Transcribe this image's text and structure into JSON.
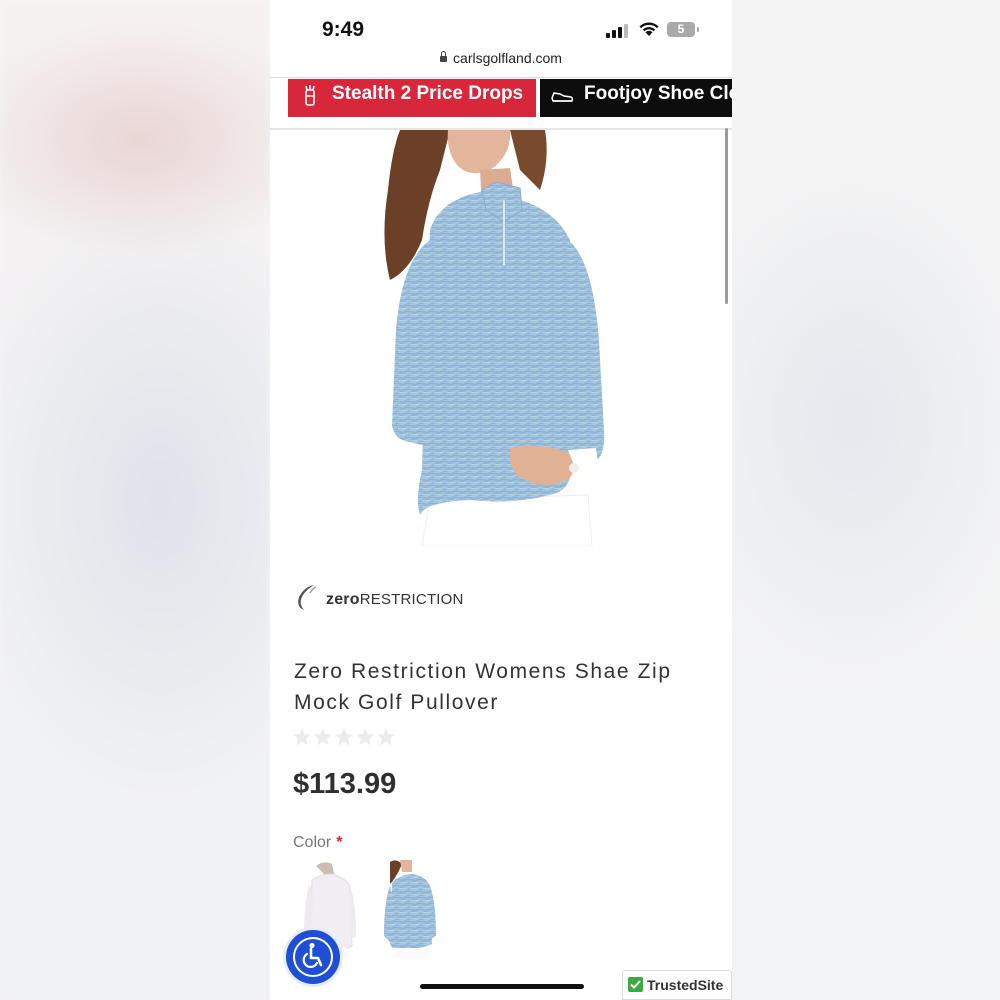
{
  "status_bar": {
    "time": "9:49",
    "battery": "5"
  },
  "browser": {
    "url": "carlsgolfland.com"
  },
  "promos": [
    {
      "label": "Stealth 2 Price Drops",
      "icon": "golf-bag-icon",
      "color": "#d8263a"
    },
    {
      "label": "Footjoy Shoe Clo",
      "icon": "shoe-icon",
      "color": "#0d0d0d"
    }
  ],
  "product": {
    "brand_bold": "zero",
    "brand_rest": "RESTRICTION",
    "title": "Zero Restriction Womens Shae Zip Mock Golf Pullover",
    "rating": 0,
    "rating_max": 5,
    "price": "$113.99",
    "color_label": "Color",
    "color_required_mark": "*",
    "color_options": [
      {
        "name": "white",
        "swatch": "#f1eef3"
      },
      {
        "name": "blue space dye",
        "swatch": "#9db8da"
      }
    ]
  },
  "badges": {
    "trusted_site": "TrustedSite"
  },
  "colors": {
    "accent_red": "#d8263a",
    "accessibility_blue": "#1e4fd6",
    "trusted_green": "#3da944"
  }
}
